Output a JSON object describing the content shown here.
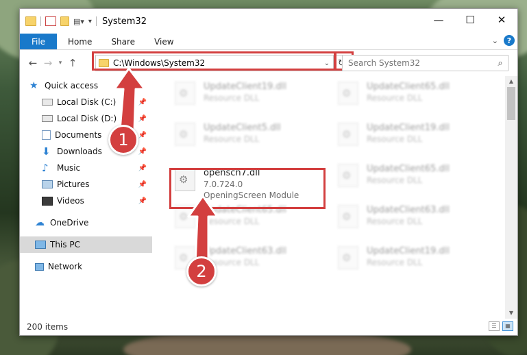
{
  "window": {
    "title": "System32"
  },
  "ribbon": {
    "tabs": [
      "File",
      "Home",
      "Share",
      "View"
    ],
    "help": "?"
  },
  "nav": {
    "address_path": "C:\\Windows\\System32",
    "search_placeholder": "Search System32"
  },
  "sidebar": {
    "items": [
      {
        "label": "Quick access",
        "icon": "star-icon"
      },
      {
        "label": "Local Disk (C:)",
        "icon": "drive-icon",
        "pinned": true
      },
      {
        "label": "Local Disk (D:)",
        "icon": "drive-icon",
        "pinned": true
      },
      {
        "label": "Documents",
        "icon": "documents-icon",
        "pinned": true
      },
      {
        "label": "Downloads",
        "icon": "downloads-icon",
        "pinned": true
      },
      {
        "label": "Music",
        "icon": "music-icon",
        "pinned": true
      },
      {
        "label": "Pictures",
        "icon": "pictures-icon",
        "pinned": true
      },
      {
        "label": "Videos",
        "icon": "videos-icon",
        "pinned": true
      },
      {
        "label": "OneDrive",
        "icon": "onedrive-icon"
      },
      {
        "label": "This PC",
        "icon": "computer-icon",
        "selected": true
      },
      {
        "label": "Network",
        "icon": "network-icon"
      }
    ]
  },
  "files": [
    {
      "name": "UpdateClient19.dll",
      "sub": "Resource DLL",
      "blurred": true
    },
    {
      "name": "UpdateClient65.dll",
      "sub": "Resource DLL",
      "blurred": true
    },
    {
      "name": "UpdateClient5.dll",
      "sub": "Resource DLL",
      "blurred": true
    },
    {
      "name": "UpdateClient19.dll",
      "sub": "Resource DLL",
      "blurred": true
    },
    {
      "name": "openscn7.dll",
      "version": "7.0.724.0",
      "sub": "OpeningScreen Module",
      "blurred": false
    },
    {
      "name": "UpdateClient65.dll",
      "sub": "Resource DLL",
      "blurred": true
    },
    {
      "name": "UpdateClient65.dll",
      "sub": "Resource DLL",
      "blurred": true
    },
    {
      "name": "UpdateClient63.dll",
      "sub": "Resource DLL",
      "blurred": true
    },
    {
      "name": "UpdateClient63.dll",
      "sub": "Resource DLL",
      "blurred": true
    },
    {
      "name": "UpdateClient19.dll",
      "sub": "Resource DLL",
      "blurred": true
    }
  ],
  "status": {
    "item_count": "200 items"
  },
  "annotations": {
    "step1": "1",
    "step2": "2",
    "highlight_color": "#d33f3f"
  },
  "colors": {
    "accent": "#1979ca"
  }
}
